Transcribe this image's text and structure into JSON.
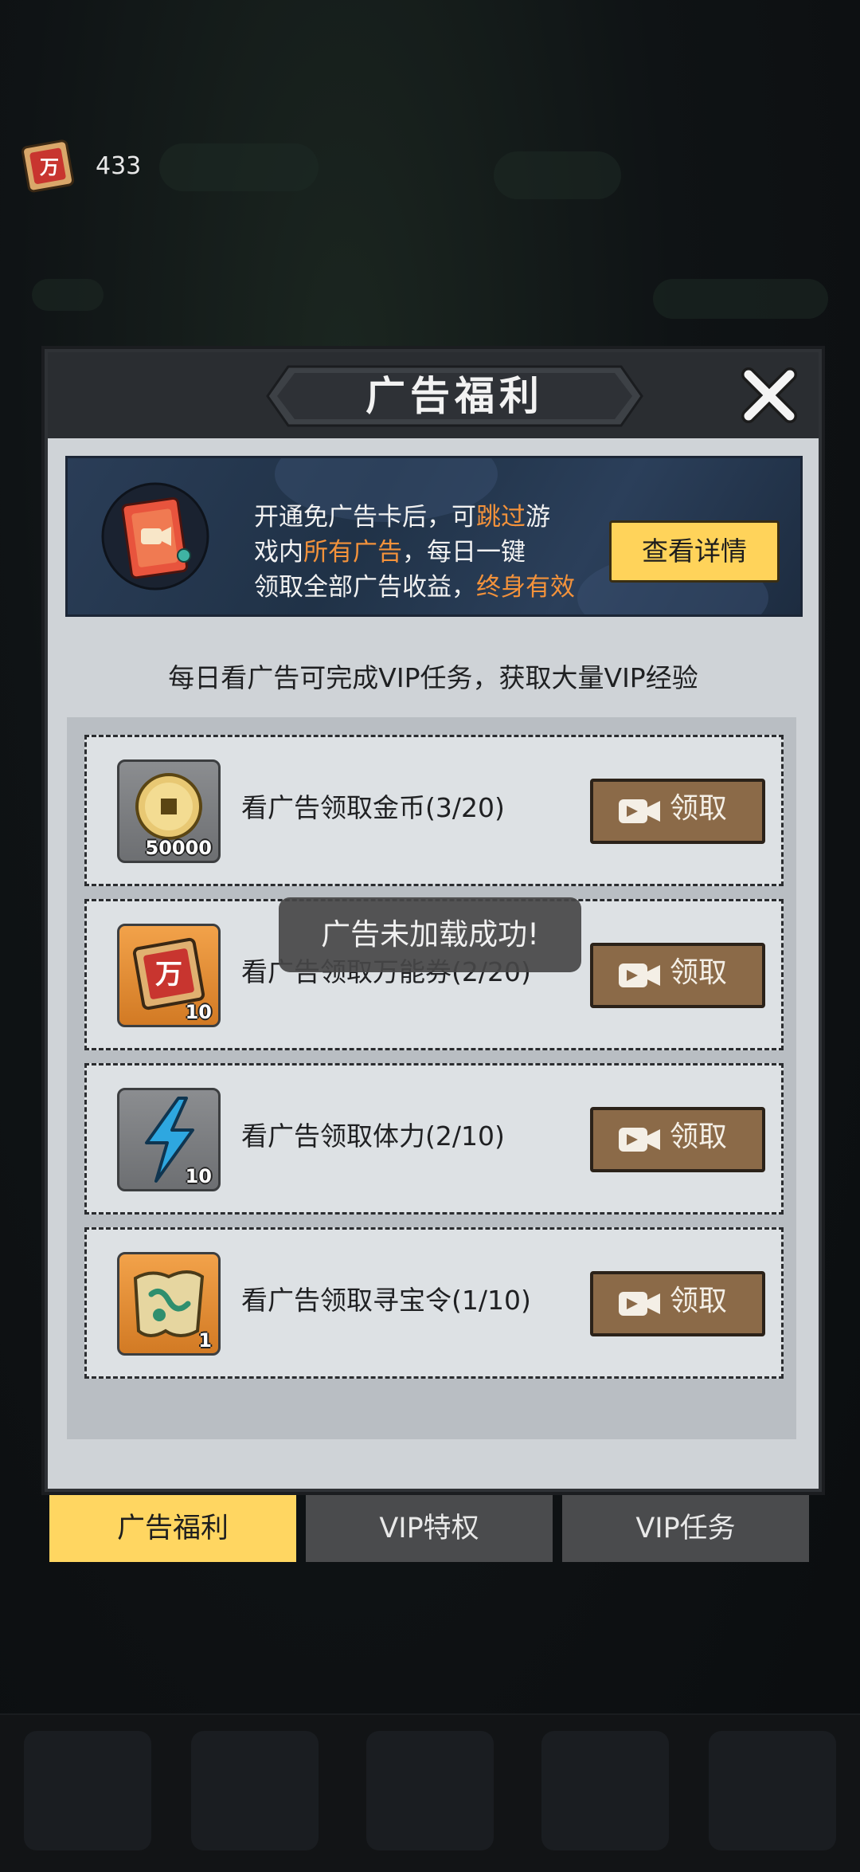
{
  "currency": {
    "icon": "voucher-scroll-icon",
    "count": "433"
  },
  "modal": {
    "title": "广告福利",
    "close_icon": "close-icon",
    "banner": {
      "line1_a": "开通免广告卡后，可",
      "line1_hl": "跳过",
      "line1_b": "游",
      "line2_a": "戏内",
      "line2_hl": "所有广告",
      "line2_b": "，每日一键",
      "line3_a": "领取全部广告收益，",
      "line3_hl": "终身有效",
      "details_label": "查看详情",
      "highlight_color": "#f3923b"
    },
    "tagline": "每日看广告可完成VIP任务，获取大量VIP经验",
    "tasks": [
      {
        "label": "看广告领取金币(3/20)",
        "qty": "50000",
        "icon": "gold-coin-icon",
        "claim": "领取"
      },
      {
        "label": "看广告领取万能券(2/20)",
        "qty": "10",
        "icon": "voucher-scroll-icon",
        "claim": "领取"
      },
      {
        "label": "看广告领取体力(2/10)",
        "qty": "10",
        "icon": "lightning-icon",
        "claim": "领取"
      },
      {
        "label": "看广告领取寻宝令(1/10)",
        "qty": "1",
        "icon": "treasure-map-icon",
        "claim": "领取"
      }
    ]
  },
  "tabs": [
    {
      "label": "广告福利",
      "active": true
    },
    {
      "label": "VIP特权",
      "active": false
    },
    {
      "label": "VIP任务",
      "active": false
    }
  ],
  "toast": "广告未加载成功!",
  "colors": {
    "tab_active": "#ffd661",
    "claim_button": "#8b6a48",
    "details_button": "#ffd35a"
  }
}
